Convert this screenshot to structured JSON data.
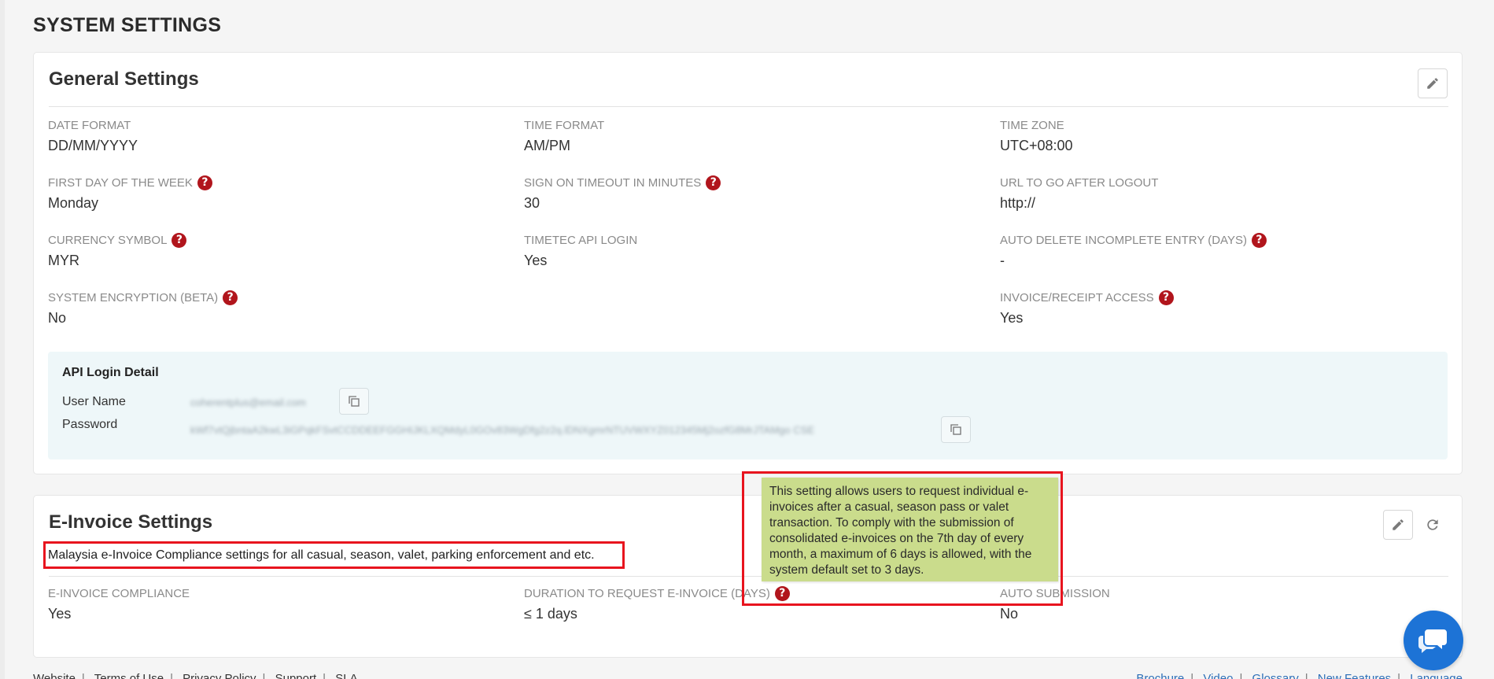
{
  "page": {
    "title": "SYSTEM SETTINGS"
  },
  "general": {
    "title": "General Settings",
    "fields": [
      {
        "label": "DATE FORMAT",
        "value": "DD/MM/YYYY"
      },
      {
        "label": "TIME FORMAT",
        "value": "AM/PM"
      },
      {
        "label": "TIME ZONE",
        "value": "UTC+08:00"
      },
      {
        "label": "FIRST DAY OF THE WEEK",
        "value": "Monday"
      },
      {
        "label": "SIGN ON TIMEOUT IN MINUTES",
        "value": "30"
      },
      {
        "label": "URL TO GO AFTER LOGOUT",
        "value": "http://"
      },
      {
        "label": "CURRENCY SYMBOL",
        "value": "MYR"
      },
      {
        "label": "TIMETEC API LOGIN",
        "value": "Yes"
      },
      {
        "label": "AUTO DELETE INCOMPLETE ENTRY (DAYS)",
        "value": "-"
      },
      {
        "label": "SYSTEM ENCRYPTION (BETA)",
        "value": "No"
      },
      {
        "label": "INVOICE/RECEIPT ACCESS",
        "value": "Yes"
      }
    ],
    "api": {
      "title": "API Login Detail",
      "username_label": "User Name",
      "password_label": "Password",
      "username_value": "coherentplus@email.com",
      "password_value": "kWf7vtQjbntaA2kwL3iGPqkFSvtCCDDEEFGGHIJKLXQMdyL0GOv83WgDfg2z2q.lDNXgmrNTUVWXYZ012345Mj2ozfG8MrJTAMgo CSE"
    }
  },
  "einvoice": {
    "title": "E-Invoice Settings",
    "description": "Malaysia e-Invoice Compliance settings for all casual, season, valet, parking enforcement and etc.",
    "fields": [
      {
        "label": "E-INVOICE COMPLIANCE",
        "value": "Yes"
      },
      {
        "label": "DURATION TO REQUEST E-INVOICE (DAYS)",
        "value": "≤ 1 days"
      },
      {
        "label": "AUTO SUBMISSION",
        "value": "No"
      }
    ],
    "tooltip": "This setting allows users to request individual e-invoices after a casual, season pass or valet transaction. To comply with the submission of consolidated e-invoices on the 7th day of every month, a maximum of 6 days is allowed, with the system default set to 3 days."
  },
  "icons": {
    "help": "?",
    "edit": "pencil-icon",
    "refresh": "refresh-icon",
    "copy": "copy-icon",
    "chat": "chat-icon"
  },
  "colors": {
    "help_icon": "#b1151c",
    "highlight_box": "#e8141e",
    "tooltip_bg": "#cadc8c",
    "link": "#2d6fb8",
    "chat": "#1d73d6"
  },
  "footer": {
    "left": [
      "Website",
      "Terms of Use",
      "Privacy Policy",
      "Support",
      "SLA"
    ],
    "right": [
      "Brochure",
      "Video",
      "Glossary",
      "New Features",
      "Language"
    ]
  }
}
